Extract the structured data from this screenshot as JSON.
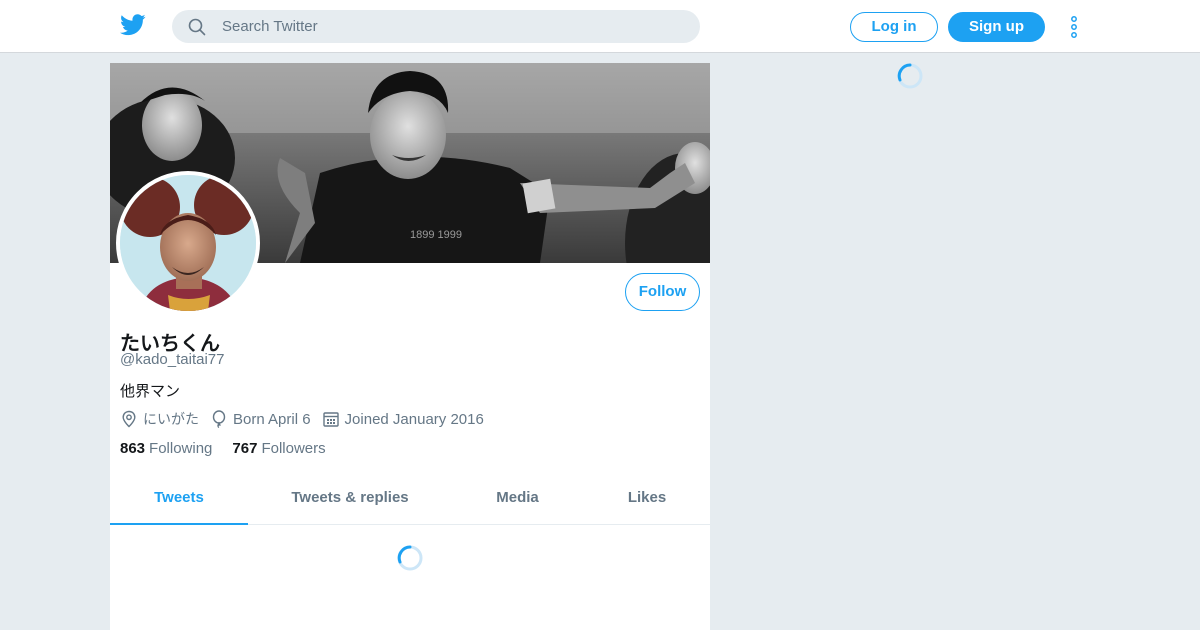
{
  "topbar": {
    "search_placeholder": "Search Twitter",
    "login_label": "Log in",
    "signup_label": "Sign up"
  },
  "profile": {
    "display_name": "たいちくん",
    "handle": "@kado_taitai77",
    "bio": "他界マン",
    "location": "にいがた",
    "birthday": "Born April 6",
    "joined": "Joined January 2016",
    "following_count": "863",
    "following_label": "Following",
    "followers_count": "767",
    "followers_label": "Followers",
    "follow_label": "Follow"
  },
  "tabs": [
    {
      "label": "Tweets",
      "active": true
    },
    {
      "label": "Tweets & replies",
      "active": false
    },
    {
      "label": "Media",
      "active": false
    },
    {
      "label": "Likes",
      "active": false
    }
  ],
  "banner_text": "1899 1999",
  "colors": {
    "accent": "#1da1f2",
    "background": "#e6ecf0",
    "secondary_text": "#657786"
  },
  "icons": [
    "twitter-logo-icon",
    "search-icon",
    "more-vertical-icon",
    "location-pin-icon",
    "balloon-icon",
    "calendar-icon",
    "loading-spinner-icon"
  ]
}
